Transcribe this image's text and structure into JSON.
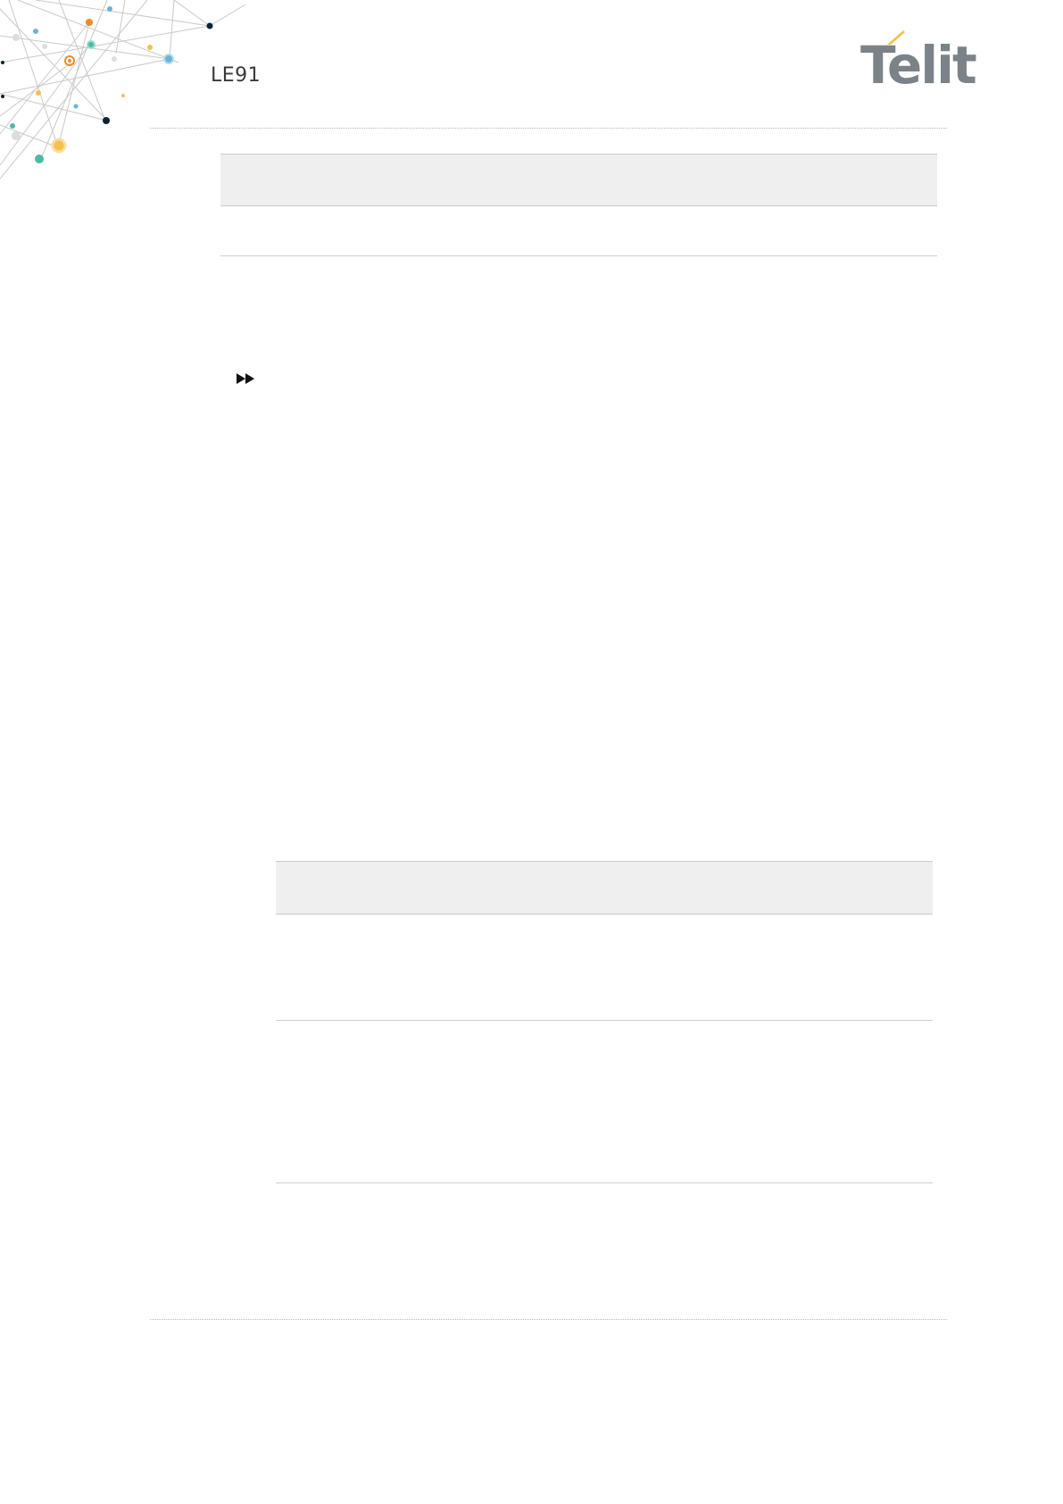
{
  "header": {
    "model": "LE91",
    "brand_logo_text": "Telit",
    "decoration": "network-nodes-graphic"
  },
  "icons": {
    "note_marker": "fast-forward-icon"
  },
  "colors": {
    "logo_gray": "#7b8288",
    "logo_accent": "#f2c14e",
    "table_header_bg": "#efefef",
    "rule": "#b9b9b9"
  },
  "tables": [
    {
      "id": "table-1",
      "header_cells": [],
      "rows": []
    },
    {
      "id": "table-2",
      "header_cells": [],
      "rows": []
    }
  ]
}
